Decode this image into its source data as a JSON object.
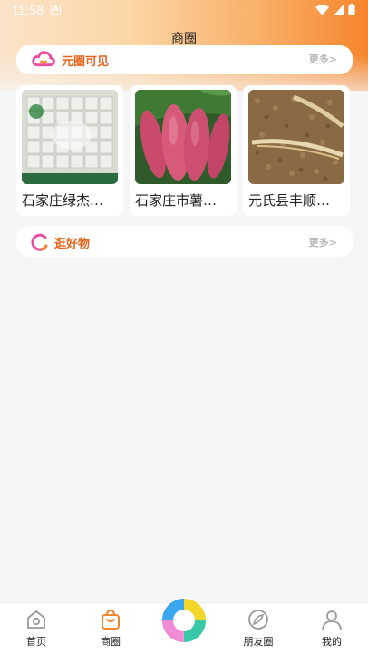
{
  "status_bar": {
    "time": "11:58",
    "notif_letter": "A"
  },
  "header": {
    "title": "商圈"
  },
  "section_yuanquan": {
    "title": "元圈可见",
    "more": "更多>"
  },
  "products": [
    {
      "name": "石家庄绿杰…"
    },
    {
      "name": "石家庄市薯…"
    },
    {
      "name": "元氏县丰顺…"
    }
  ],
  "section_guang": {
    "title": "逛好物",
    "more": "更多>"
  },
  "tabbar": {
    "items": [
      {
        "label": "首页",
        "icon": "home-icon"
      },
      {
        "label": "商圈",
        "icon": "shopping-bag-icon",
        "active": true
      },
      {
        "label": "朋友圈",
        "icon": "compass-icon"
      },
      {
        "label": "我的",
        "icon": "person-icon"
      }
    ]
  },
  "colors": {
    "accent": "#f5852c",
    "title_orange": "#e8641e",
    "more_gray": "#b7b7b7"
  }
}
